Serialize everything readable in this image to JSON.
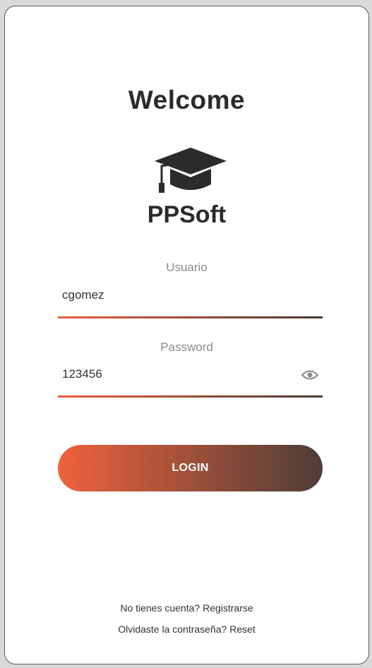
{
  "header": {
    "title": "Welcome",
    "brand": "PPSoft",
    "logo_icon": "graduation-cap-icon"
  },
  "form": {
    "username": {
      "label": "Usuario",
      "value": "cgomez"
    },
    "password": {
      "label": "Password",
      "value": "123456",
      "toggle_icon": "eye-icon"
    },
    "login_label": "LOGIN"
  },
  "footer": {
    "register_prompt": "No tienes cuenta?",
    "register_link": "Registrarse",
    "reset_prompt": "Olvidaste la contraseña?",
    "reset_link": "Reset"
  },
  "colors": {
    "accent_start": "#ee5e3b",
    "accent_end": "#4a3a34",
    "text_dark": "#2b2b2b",
    "label_gray": "#8a8a8a"
  }
}
